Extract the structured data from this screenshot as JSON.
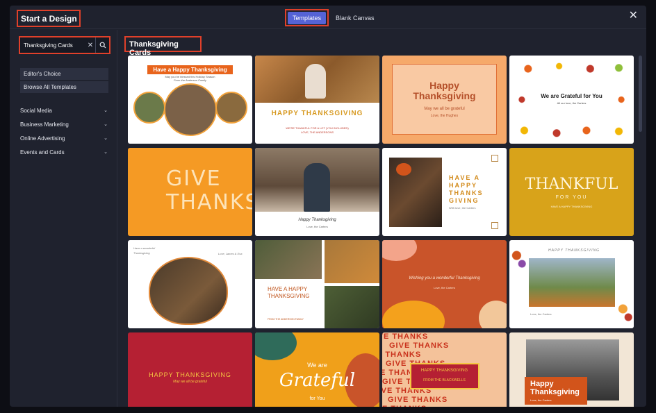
{
  "header": {
    "title": "Start a Design",
    "tab_templates": "Templates",
    "tab_blank": "Blank Canvas",
    "close_icon": "close-icon"
  },
  "sidebar": {
    "search_value": "Thanksgiving Cards",
    "quick_links": [
      "Editor's Choice",
      "Browse All Templates"
    ],
    "categories": [
      "Social Media",
      "Business Marketing",
      "Online Advertising",
      "Events and Cards"
    ]
  },
  "main": {
    "section_title": "Thanksgiving Cards",
    "cards": [
      {
        "headline": "Have a Happy Thanksgiving",
        "sub": "May you be blessed this Holiday Season",
        "sub2": "From the Anderson Family"
      },
      {
        "headline": "HAPPY THANKSGIVING",
        "sub": "WE'RE THANKFUL FOR A LOT (YOU INCLUDED)",
        "sub2": "LOVE, THE ANDERSONS"
      },
      {
        "headline": "Happy Thanksgiving",
        "sub": "May we all be grateful",
        "sub2": "Love, the Hughes"
      },
      {
        "headline": "We are Grateful for You",
        "sub": "All our love, the Carters"
      },
      {
        "headline": "GIVE THANKS"
      },
      {
        "headline": "Happy Thanksgiving",
        "sub": "Love, the Carters"
      },
      {
        "headline": "HAVE A HAPPY THANKS GIVING",
        "sub": "With love, the Carters"
      },
      {
        "headline": "THANKFUL",
        "sub": "FOR YOU",
        "sub2": "HAVE A HAPPY THANKSGIVING"
      },
      {
        "headline": "Have a wonderful Thanksgiving",
        "sub": "Love, James & Eva"
      },
      {
        "headline": "HAVE A HAPPY THANKSGIVING",
        "sub": "FROM THE ANDERSON FAMILY"
      },
      {
        "headline": "Wishing you a wonderful Thanksgiving",
        "sub": "Love, the Carters"
      },
      {
        "headline": "HAPPY THANKSGIVING",
        "sub": "Love, the Carters"
      },
      {
        "headline": "HAPPY THANKSGIVING",
        "sub": "May we all be grateful"
      },
      {
        "headline": "We are",
        "sub": "Grateful",
        "sub2": "for You"
      },
      {
        "headline": "HAPPY THANKSGIVING",
        "sub": "FROM THE BLACKWELLS",
        "pattern": "GIVE THANKS"
      },
      {
        "headline": "Happy",
        "sub": "Thanksgiving",
        "sub2": "Love, the Carters"
      }
    ]
  }
}
